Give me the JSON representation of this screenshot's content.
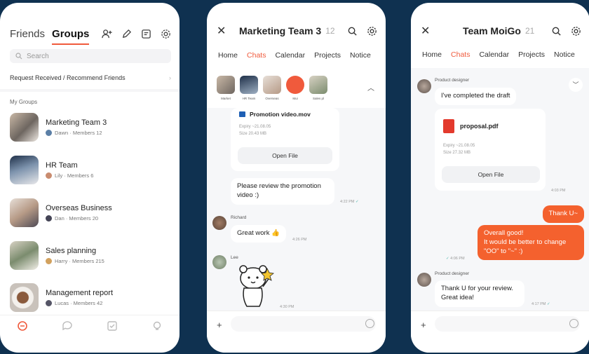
{
  "phone1": {
    "tabs": {
      "friends": "Friends",
      "groups": "Groups"
    },
    "search_placeholder": "Search",
    "request_row": "Request Received / Recommend Friends",
    "my_groups": "My Groups",
    "groups": [
      {
        "name": "Marketing Team 3",
        "meta": "Dawn · Members 12"
      },
      {
        "name": "HR Team",
        "meta": "Lily · Members 6"
      },
      {
        "name": "Overseas Business",
        "meta": "Dan · Members 20"
      },
      {
        "name": "Sales planning",
        "meta": "Harry · Members 215"
      },
      {
        "name": "Management report",
        "meta": "Lucas · Members 42"
      }
    ]
  },
  "phone2": {
    "title": "Marketing Team 3",
    "count": "12",
    "tabs": [
      "Home",
      "Chats",
      "Calendar",
      "Projects",
      "Notice"
    ],
    "shared": [
      "Market",
      "HR Team",
      "Overseas",
      "Mui",
      "Sales pl"
    ],
    "file": {
      "name": "Promotion video.mov",
      "expiry": "Expiry  ~21.08.05",
      "size": "Size  20.43 MB",
      "open": "Open File"
    },
    "msg1": {
      "text": "Please review the promotion video :)",
      "time": "4:22 PM"
    },
    "msg2": {
      "sender": "Richard",
      "text": "Great work 👍",
      "time": "4:26 PM"
    },
    "msg3": {
      "sender": "Lee",
      "time": "4:30 PM"
    }
  },
  "phone3": {
    "title": "Team MoiGo",
    "count": "21",
    "tabs": [
      "Home",
      "Chats",
      "Calendar",
      "Projects",
      "Notice"
    ],
    "msg1": {
      "sender": "Product designer",
      "text": "I've completed the draft"
    },
    "file": {
      "name": "proposal.pdf",
      "expiry": "Expiry  ~21.08.05",
      "size": "Size  27.32 MB",
      "open": "Open File",
      "time": "4:03 PM"
    },
    "me1": {
      "text": "Thank U~"
    },
    "me2": {
      "text": "Overall good!\nIt would be better to change \"OO\" to \"~\" :)",
      "time": "4:06 PM"
    },
    "msg2": {
      "sender": "Product designer",
      "text": "Thank U for your review. Great idea!",
      "time": "4:17 PM"
    }
  },
  "colors": {
    "accent": "#f05a3c",
    "bubble_me": "#f4612e",
    "background": "#0f3150"
  }
}
